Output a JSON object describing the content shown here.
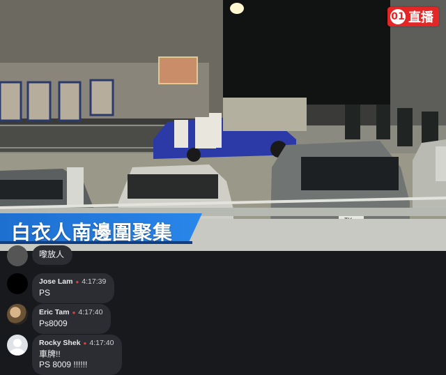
{
  "live_badge": {
    "logo": "01",
    "label": "直播",
    "color": "#e32626"
  },
  "caption": {
    "text": "白衣人南邊圍聚集",
    "color": "#1d6fd0"
  },
  "comments": [
    {
      "name": "",
      "time": "",
      "text": "嚟放人"
    },
    {
      "name": "Jose Lam",
      "time": "4:17:39",
      "text": "PS",
      "avatar": "black-circle"
    },
    {
      "name": "Eric Tam",
      "time": "4:17:40",
      "text": "Ps8009",
      "avatar": "photo"
    },
    {
      "name": "Rocky Shek",
      "time": "4:17:40",
      "text": "車牌!!\nPS 8009 !!!!!!",
      "avatar": "default-person"
    }
  ],
  "scene": {
    "plate_text": "TK"
  }
}
